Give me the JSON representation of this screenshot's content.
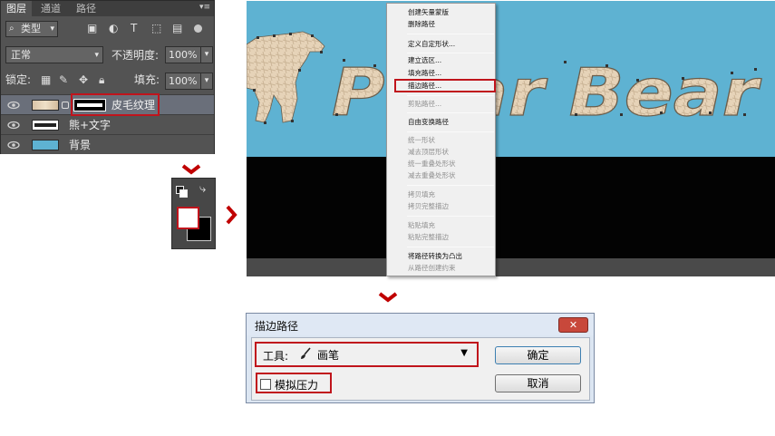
{
  "layers_panel": {
    "tabs": [
      "图层",
      "通道",
      "路径"
    ],
    "kind_filter": "类型",
    "blend_mode": "正常",
    "opacity_label": "不透明度:",
    "opacity_value": "100%",
    "lock_label": "锁定:",
    "fill_label": "填充:",
    "fill_value": "100%",
    "layers": [
      {
        "name": "皮毛纹理",
        "highlighted": true
      },
      {
        "name": "熊+文字",
        "highlighted": false
      },
      {
        "name": "背景",
        "highlighted": false
      }
    ]
  },
  "canvas": {
    "artwork_text": "Polar Bear",
    "sky_color": "#5eb2d2"
  },
  "context_menu": {
    "items": [
      {
        "label": "创建矢量蒙版",
        "enabled": true
      },
      {
        "label": "删除路径",
        "enabled": true
      },
      {
        "label": "定义自定形状...",
        "enabled": true
      },
      {
        "label": "建立选区...",
        "enabled": true
      },
      {
        "label": "填充路径...",
        "enabled": true
      },
      {
        "label": "描边路径...",
        "enabled": true,
        "highlighted": true
      },
      {
        "label": "剪贴路径...",
        "enabled": false
      },
      {
        "label": "自由变换路径",
        "enabled": true
      },
      {
        "label": "统一形状",
        "enabled": false
      },
      {
        "label": "减去顶层形状",
        "enabled": false
      },
      {
        "label": "统一重叠处形状",
        "enabled": false
      },
      {
        "label": "减去重叠处形状",
        "enabled": false
      },
      {
        "label": "拷贝填充",
        "enabled": false
      },
      {
        "label": "拷贝完整描边",
        "enabled": false
      },
      {
        "label": "粘贴填充",
        "enabled": false
      },
      {
        "label": "粘贴完整描边",
        "enabled": false
      },
      {
        "label": "将路径转换为凸出",
        "enabled": true
      },
      {
        "label": "从路径创建约束",
        "enabled": false
      }
    ]
  },
  "dialog": {
    "title": "描边路径",
    "tool_label": "工具:",
    "tool_value": "画笔",
    "simulate_pressure_label": "模拟压力",
    "simulate_pressure_checked": false,
    "ok_label": "确定",
    "cancel_label": "取消"
  },
  "colors": {
    "highlight_red": "#c0141c",
    "arrow_red": "#c00000",
    "panel_gray": "#535353"
  }
}
